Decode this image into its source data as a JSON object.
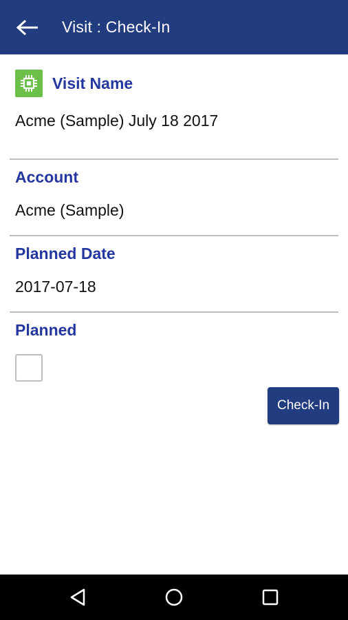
{
  "appbar": {
    "title": "Visit : Check-In",
    "back_icon": "arrow-left-icon",
    "color": "#213c7f"
  },
  "form": {
    "visit_name": {
      "label": "Visit Name",
      "value": "Acme (Sample) July 18 2017",
      "icon": "chip-icon"
    },
    "account": {
      "label": "Account",
      "value": "Acme (Sample)"
    },
    "planned_date": {
      "label": "Planned Date",
      "value": "2017-07-18"
    },
    "planned": {
      "label": "Planned",
      "checked": false
    }
  },
  "actions": {
    "checkin_label": "Check-In"
  },
  "navbar": {
    "back_icon": "triangle-back-icon",
    "home_icon": "circle-home-icon",
    "recents_icon": "square-recents-icon"
  },
  "colors": {
    "label": "#2436a0",
    "icon_bg": "#6cc04a",
    "divider": "#bdbdbd"
  }
}
